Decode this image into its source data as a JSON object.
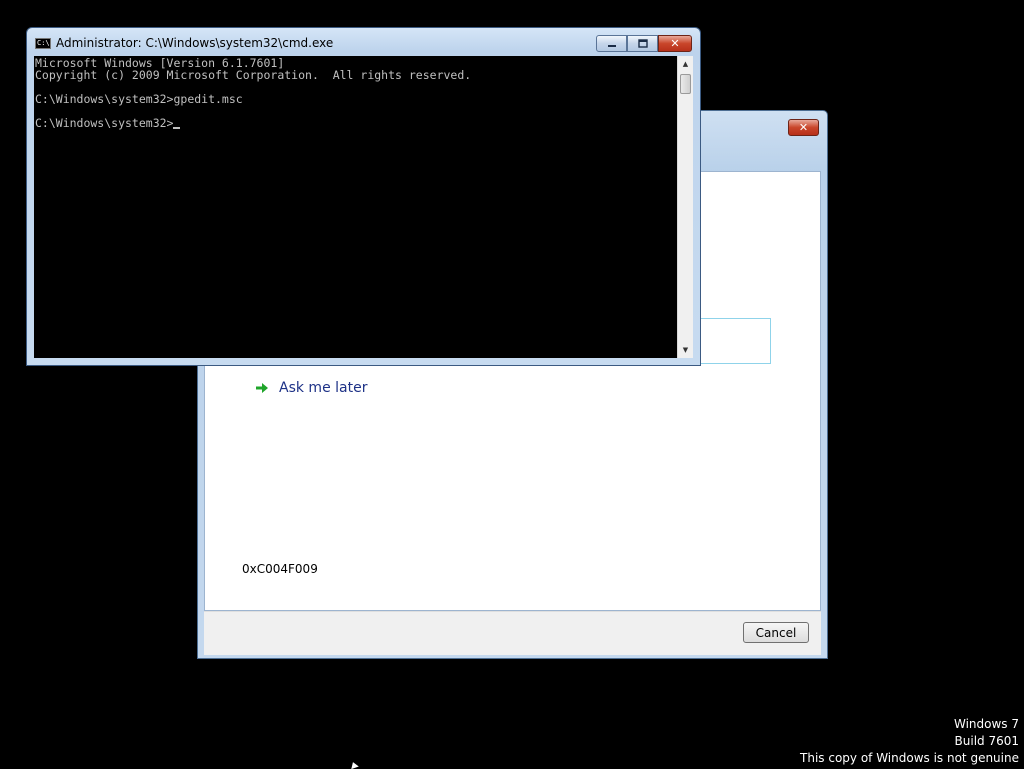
{
  "activation_dialog": {
    "close_glyph": "✕",
    "ask_later_label": "Ask me later",
    "ask_later_icon": "green-arrow-icon",
    "error_code": "0xC004F009",
    "cancel_label": "Cancel"
  },
  "cmd_window": {
    "title": "Administrator: C:\\Windows\\system32\\cmd.exe",
    "icon": "cmd-icon",
    "minimize_glyph": "▁",
    "maximize_glyph": "▭",
    "close_glyph": "✕",
    "console_lines": [
      "Microsoft Windows [Version 6.1.7601]",
      "Copyright (c) 2009 Microsoft Corporation.  All rights reserved.",
      "",
      "C:\\Windows\\system32>gpedit.msc",
      "",
      "C:\\Windows\\system32>"
    ]
  },
  "watermark": {
    "line1": "Windows 7",
    "line2": "Build 7601",
    "line3": "This copy of Windows is not genuine"
  },
  "colors": {
    "desktop": "#000000",
    "console_bg": "#000000",
    "console_text": "#c0c0c0",
    "link_text": "#1e3287",
    "arrow_green": "#1fa52a"
  }
}
